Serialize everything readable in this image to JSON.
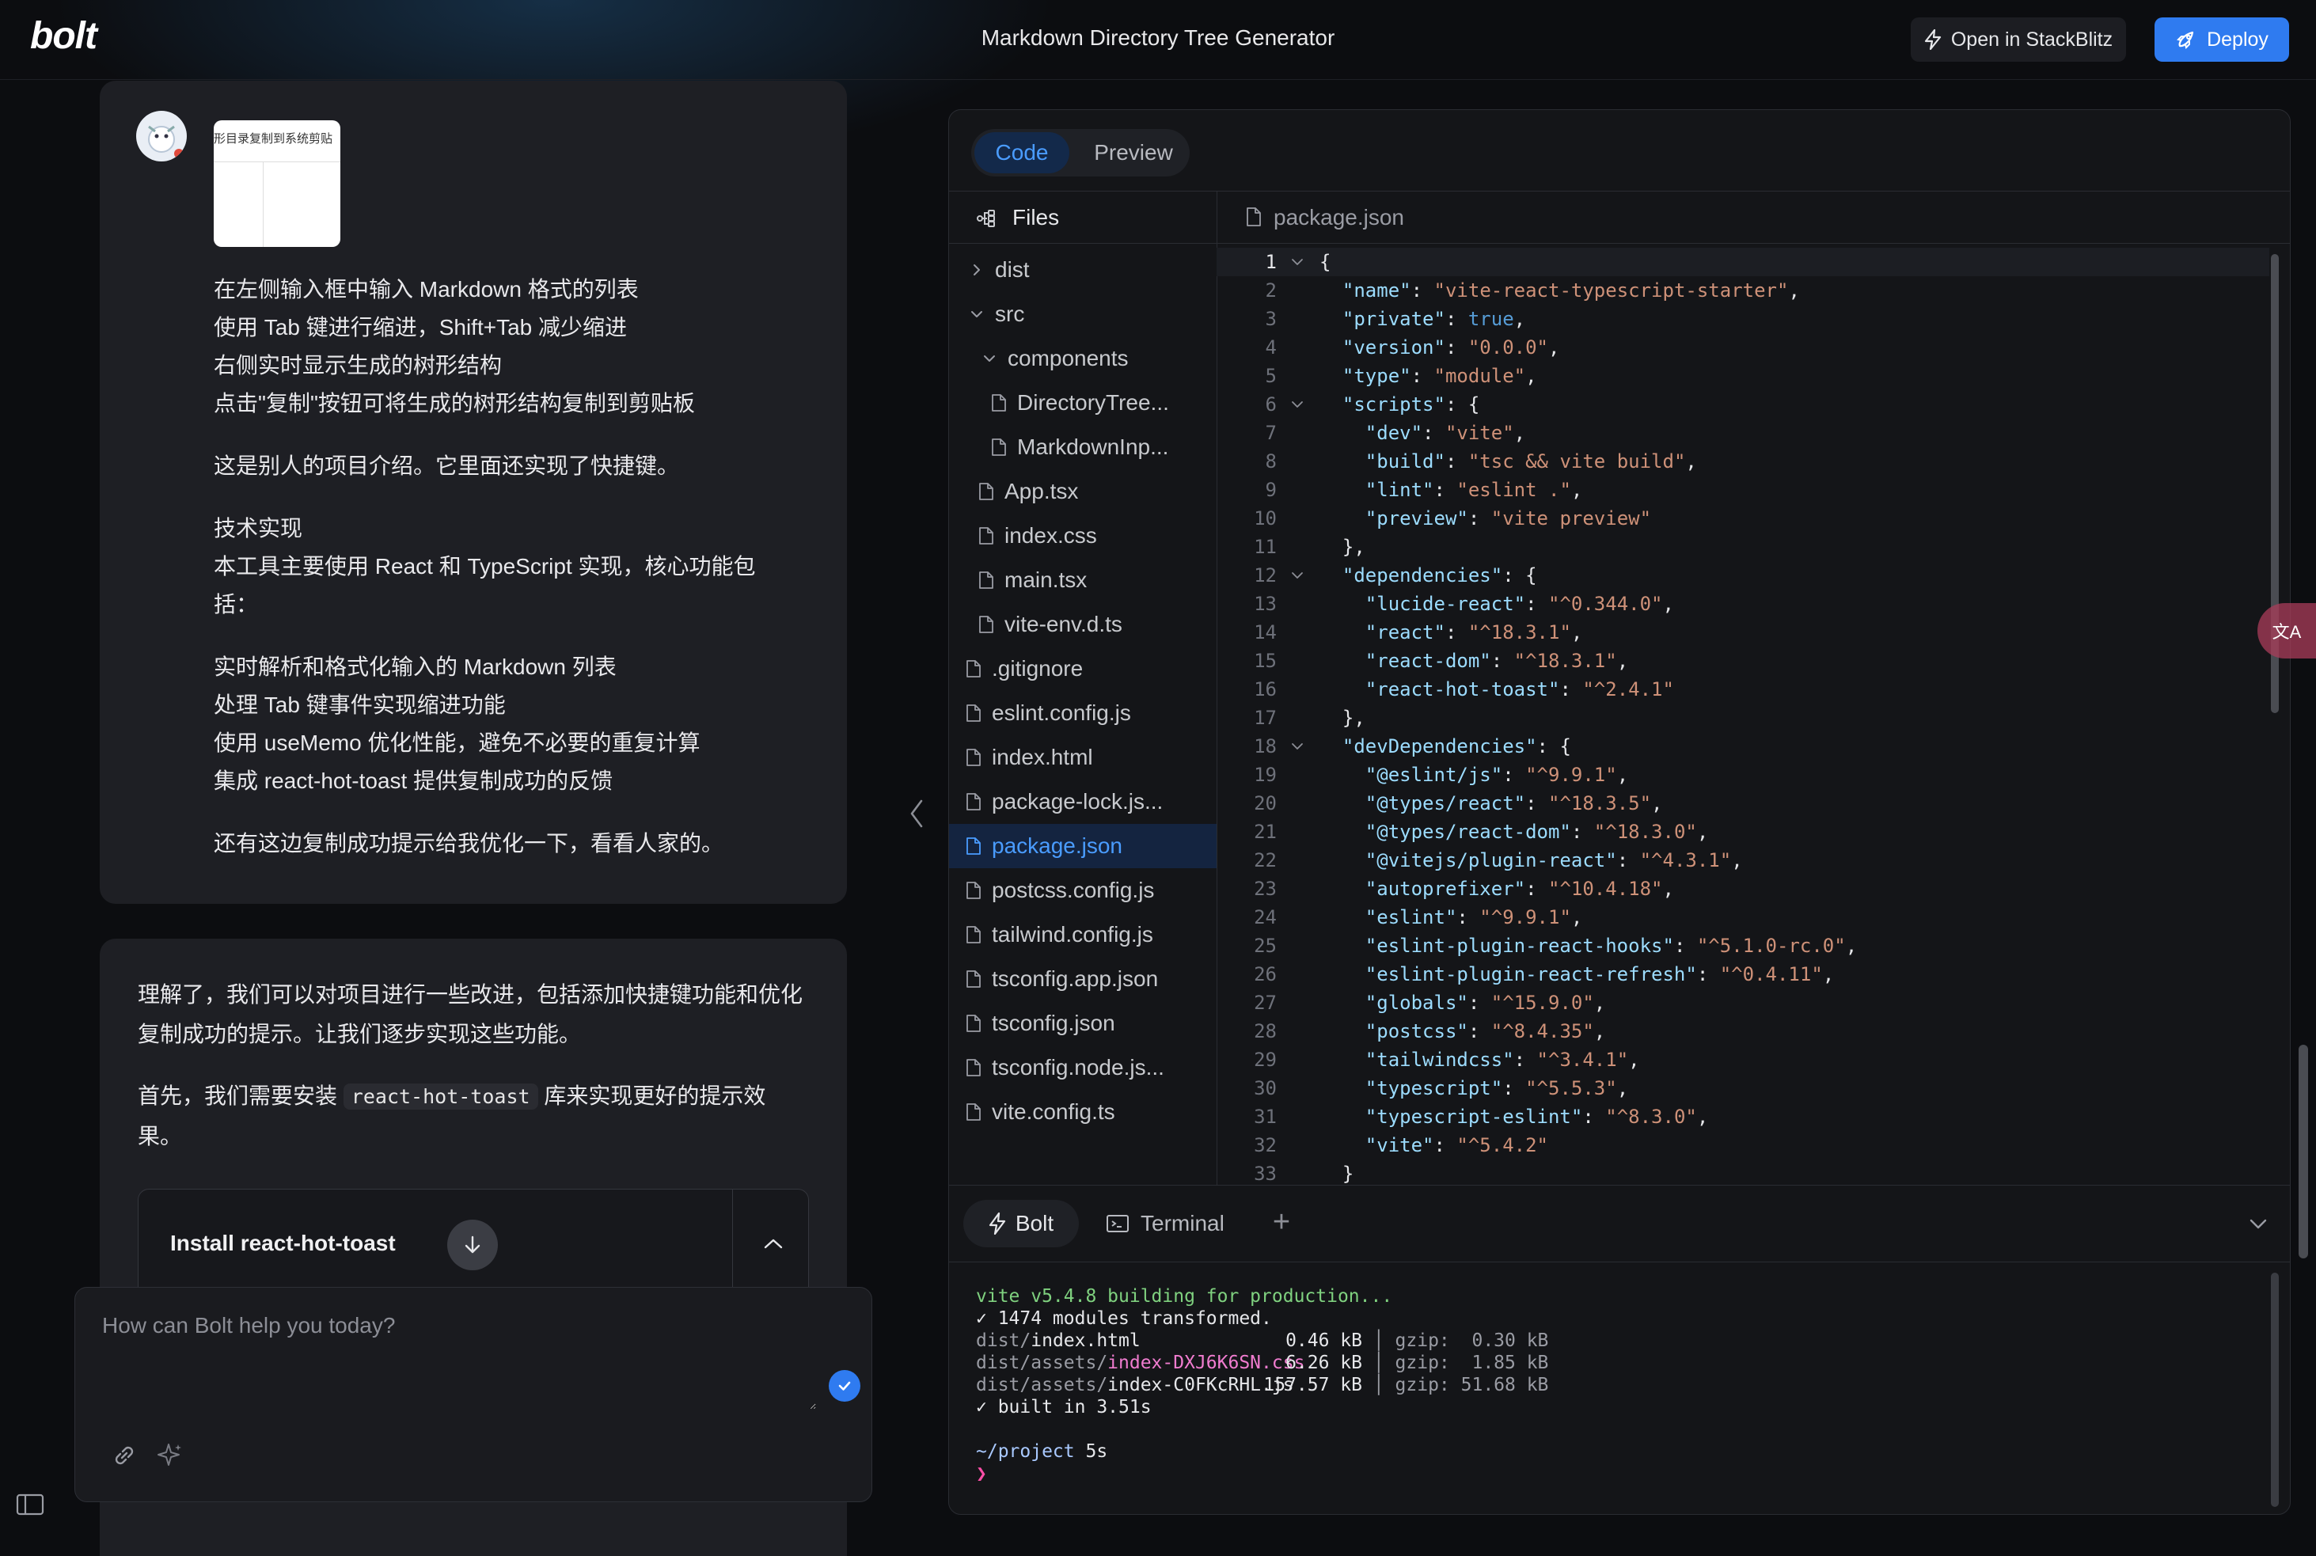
{
  "header": {
    "logo": "bolt",
    "title": "Markdown Directory Tree Generator",
    "open_label": "Open in StackBlitz",
    "deploy_label": "Deploy",
    "open_icon": "lightning-icon",
    "deploy_icon": "rocket-icon"
  },
  "chat": {
    "user_message": {
      "thumbnail_text": "形目录复制到系统剪贴",
      "paragraphs": [
        [
          "在左侧输入框中输入 Markdown 格式的列表",
          "使用 Tab 键进行缩进，Shift+Tab 减少缩进",
          "右侧实时显示生成的树形结构",
          "点击\"复制\"按钮可将生成的树形结构复制到剪贴板"
        ],
        [
          "这是别人的项目介绍。它里面还实现了快捷键。"
        ],
        [
          "技术实现",
          "本工具主要使用 React 和 TypeScript 实现，核心功能包",
          "括："
        ],
        [
          "实时解析和格式化输入的 Markdown 列表",
          "处理 Tab 键事件实现缩进功能",
          "使用 useMemo 优化性能，避免不必要的重复计算",
          "集成 react-hot-toast 提供复制成功的反馈"
        ],
        [
          "还有这边复制成功提示给我优化一下，看看人家的。"
        ]
      ]
    },
    "ai_message": {
      "p1_line1": "理解了，我们可以对项目进行一些改进，包括添加快捷键功能和优化",
      "p1_line2": "复制成功的提示。让我们逐步实现这些功能。",
      "p2_before": "首先，我们需要安装",
      "p2_code": "react-hot-toast",
      "p2_after": "库来实现更好的提示效",
      "p2_line2": "果。",
      "action_title": "Install react-hot-toast"
    },
    "prompt_placeholder": "How can Bolt help you today?"
  },
  "workbench": {
    "tabs": {
      "code": "Code",
      "preview": "Preview"
    },
    "files_title": "Files",
    "tree": [
      {
        "name": "dist",
        "type": "folder",
        "open": false,
        "depth": 0
      },
      {
        "name": "src",
        "type": "folder",
        "open": true,
        "depth": 0
      },
      {
        "name": "components",
        "type": "folder",
        "open": true,
        "depth": 1
      },
      {
        "name": "DirectoryTree...",
        "type": "file",
        "depth": 2
      },
      {
        "name": "MarkdownInp...",
        "type": "file",
        "depth": 2
      },
      {
        "name": "App.tsx",
        "type": "file",
        "depth": 1
      },
      {
        "name": "index.css",
        "type": "file",
        "depth": 1
      },
      {
        "name": "main.tsx",
        "type": "file",
        "depth": 1
      },
      {
        "name": "vite-env.d.ts",
        "type": "file",
        "depth": 1
      },
      {
        "name": ".gitignore",
        "type": "file",
        "depth": 0
      },
      {
        "name": "eslint.config.js",
        "type": "file",
        "depth": 0
      },
      {
        "name": "index.html",
        "type": "file",
        "depth": 0
      },
      {
        "name": "package-lock.js...",
        "type": "file",
        "depth": 0
      },
      {
        "name": "package.json",
        "type": "file",
        "depth": 0,
        "selected": true
      },
      {
        "name": "postcss.config.js",
        "type": "file",
        "depth": 0
      },
      {
        "name": "tailwind.config.js",
        "type": "file",
        "depth": 0
      },
      {
        "name": "tsconfig.app.json",
        "type": "file",
        "depth": 0
      },
      {
        "name": "tsconfig.json",
        "type": "file",
        "depth": 0
      },
      {
        "name": "tsconfig.node.js...",
        "type": "file",
        "depth": 0
      },
      {
        "name": "vite.config.ts",
        "type": "file",
        "depth": 0
      }
    ],
    "editor_filename": "package.json",
    "code_lines": [
      {
        "t": "{",
        "fold": true
      },
      {
        "t": "  \"name\": \"vite-react-typescript-starter\","
      },
      {
        "t": "  \"private\": true,"
      },
      {
        "t": "  \"version\": \"0.0.0\","
      },
      {
        "t": "  \"type\": \"module\","
      },
      {
        "t": "  \"scripts\": {",
        "fold": true
      },
      {
        "t": "    \"dev\": \"vite\","
      },
      {
        "t": "    \"build\": \"tsc && vite build\","
      },
      {
        "t": "    \"lint\": \"eslint .\","
      },
      {
        "t": "    \"preview\": \"vite preview\""
      },
      {
        "t": "  },"
      },
      {
        "t": "  \"dependencies\": {",
        "fold": true
      },
      {
        "t": "    \"lucide-react\": \"^0.344.0\","
      },
      {
        "t": "    \"react\": \"^18.3.1\","
      },
      {
        "t": "    \"react-dom\": \"^18.3.1\","
      },
      {
        "t": "    \"react-hot-toast\": \"^2.4.1\""
      },
      {
        "t": "  },"
      },
      {
        "t": "  \"devDependencies\": {",
        "fold": true
      },
      {
        "t": "    \"@eslint/js\": \"^9.9.1\","
      },
      {
        "t": "    \"@types/react\": \"^18.3.5\","
      },
      {
        "t": "    \"@types/react-dom\": \"^18.3.0\","
      },
      {
        "t": "    \"@vitejs/plugin-react\": \"^4.3.1\","
      },
      {
        "t": "    \"autoprefixer\": \"^10.4.18\","
      },
      {
        "t": "    \"eslint\": \"^9.9.1\","
      },
      {
        "t": "    \"eslint-plugin-react-hooks\": \"^5.1.0-rc.0\","
      },
      {
        "t": "    \"eslint-plugin-react-refresh\": \"^0.4.11\","
      },
      {
        "t": "    \"globals\": \"^15.9.0\","
      },
      {
        "t": "    \"postcss\": \"^8.4.35\","
      },
      {
        "t": "    \"tailwindcss\": \"^3.4.1\","
      },
      {
        "t": "    \"typescript\": \"^5.5.3\","
      },
      {
        "t": "    \"typescript-eslint\": \"^8.3.0\","
      },
      {
        "t": "    \"vite\": \"^5.4.2\""
      },
      {
        "t": "  }"
      }
    ],
    "terminal": {
      "tab_bolt": "Bolt",
      "tab_terminal": "Terminal",
      "add": "+",
      "build_line": "vite v5.4.8 building for production...",
      "modules_line": "✓ 1474 modules transformed.",
      "outputs": [
        {
          "dir": "dist/",
          "file": "index.html",
          "file_color": "white",
          "size": "0.46 kB",
          "gzip": "gzip:  0.30 kB"
        },
        {
          "dir": "dist/assets/",
          "file": "index-DXJ6K6SN.css",
          "file_color": "magenta",
          "size": "6.26 kB",
          "gzip": "gzip:  1.85 kB"
        },
        {
          "dir": "dist/assets/",
          "file": "index-C0FKcRHL.js",
          "file_color": "white",
          "size": "157.57 kB",
          "gzip": "gzip: 51.68 kB"
        }
      ],
      "built_line": "✓ built in 3.51s",
      "prompt_path": "~/project",
      "prompt_time": "5s",
      "caret": "❯"
    }
  },
  "side_badge": "文A",
  "colors": {
    "accent": "#2f7bf0",
    "selected_bg": "#142440",
    "json_key": "#9cdcfe",
    "json_string": "#ce9178",
    "json_bool": "#569cd6"
  }
}
